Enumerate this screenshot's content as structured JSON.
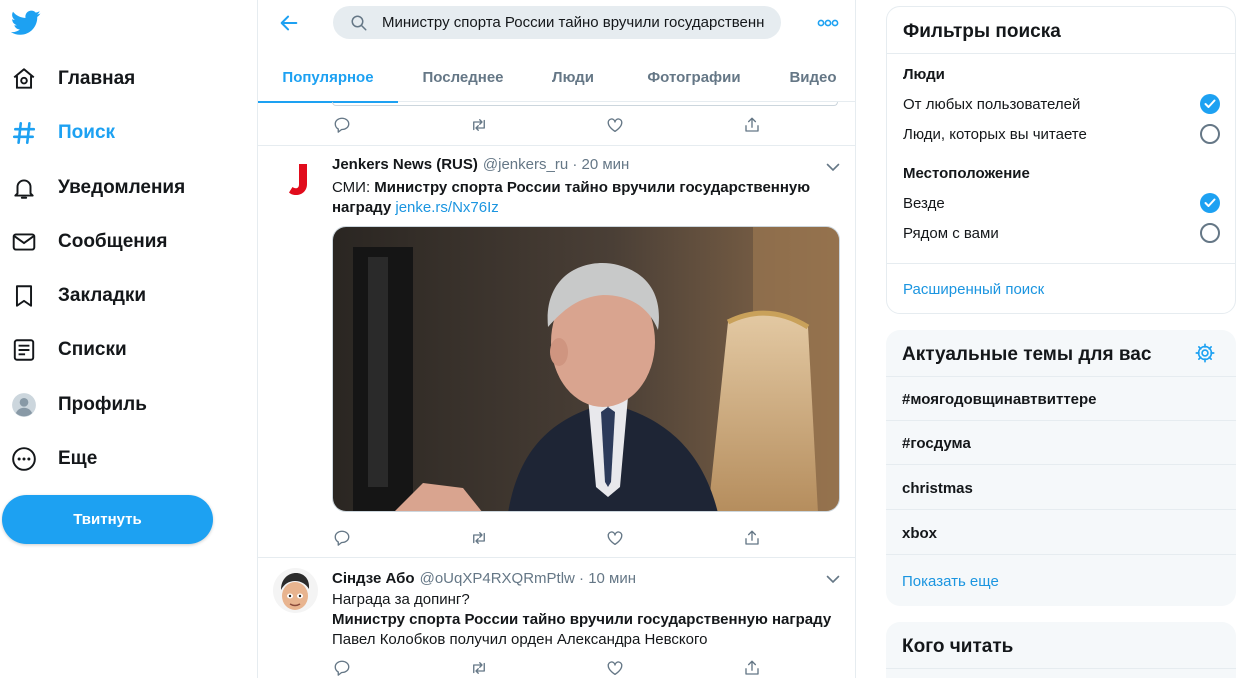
{
  "nav": {
    "items": [
      {
        "label": "Главная",
        "icon": "home-icon"
      },
      {
        "label": "Поиск",
        "icon": "hashtag-icon"
      },
      {
        "label": "Уведомления",
        "icon": "bell-icon"
      },
      {
        "label": "Сообщения",
        "icon": "mail-icon"
      },
      {
        "label": "Закладки",
        "icon": "bookmark-icon"
      },
      {
        "label": "Списки",
        "icon": "list-icon"
      },
      {
        "label": "Профиль",
        "icon": "profile-icon"
      },
      {
        "label": "Еще",
        "icon": "more-circle-icon"
      }
    ],
    "tweet_button": "Твитнуть"
  },
  "search": {
    "query": "Министру спорта России тайно вручили государственн"
  },
  "tabs": [
    "Популярное",
    "Последнее",
    "Люди",
    "Фотографии",
    "Видео"
  ],
  "tweets": [
    {
      "name": "Jenkers News (RUS)",
      "handle": "@jenkers_ru · 20 мин",
      "text_prefix": "СМИ: ",
      "text_bold": "Министру спорта России тайно вручили государственную награду",
      "link": "jenke.rs/Nx76Iz"
    },
    {
      "name": "Сiндзе Або",
      "handle": "@oUqXP4RXQRmPtlw · 10 мин",
      "line1": "Награда за допинг?",
      "line2": "Министру спорта России тайно вручили государственную награду",
      "line3": "Павел Колобков получил орден Александра Невского"
    }
  ],
  "filters": {
    "title": "Фильтры поиска",
    "people_label": "Люди",
    "people_options": [
      "От любых пользователей",
      "Люди, которых вы читаете"
    ],
    "location_label": "Местоположение",
    "location_options": [
      "Везде",
      "Рядом с вами"
    ],
    "advanced": "Расширенный поиск"
  },
  "trends": {
    "title": "Актуальные темы для вас",
    "items": [
      "#моягодовщинавтвиттере",
      "#госдума",
      "christmas",
      "xbox"
    ],
    "show_more": "Показать еще"
  },
  "who_to_follow": {
    "title": "Кого читать"
  },
  "colors": {
    "accent": "#1da1f2",
    "text": "#14171a",
    "muted": "#657786",
    "border": "#e6ecf0"
  }
}
